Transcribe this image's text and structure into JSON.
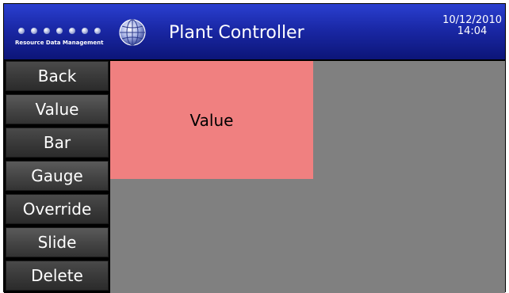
{
  "header": {
    "brand_text": "Resource Data Management",
    "title": "Plant Controller",
    "date": "10/12/2010",
    "time": "14:04"
  },
  "sidebar": {
    "items": [
      {
        "label": "Back"
      },
      {
        "label": "Value"
      },
      {
        "label": "Bar"
      },
      {
        "label": "Gauge"
      },
      {
        "label": "Override"
      },
      {
        "label": "Slide"
      },
      {
        "label": "Delete"
      }
    ]
  },
  "workspace": {
    "widget_label": "Value"
  },
  "colors": {
    "header_blue": "#1a28a6",
    "button_gray": "#3a3a3a",
    "workspace_gray": "#808080",
    "widget_pink": "#f08080"
  },
  "icons": [
    "globe-icon",
    "brand-dots-icon"
  ]
}
